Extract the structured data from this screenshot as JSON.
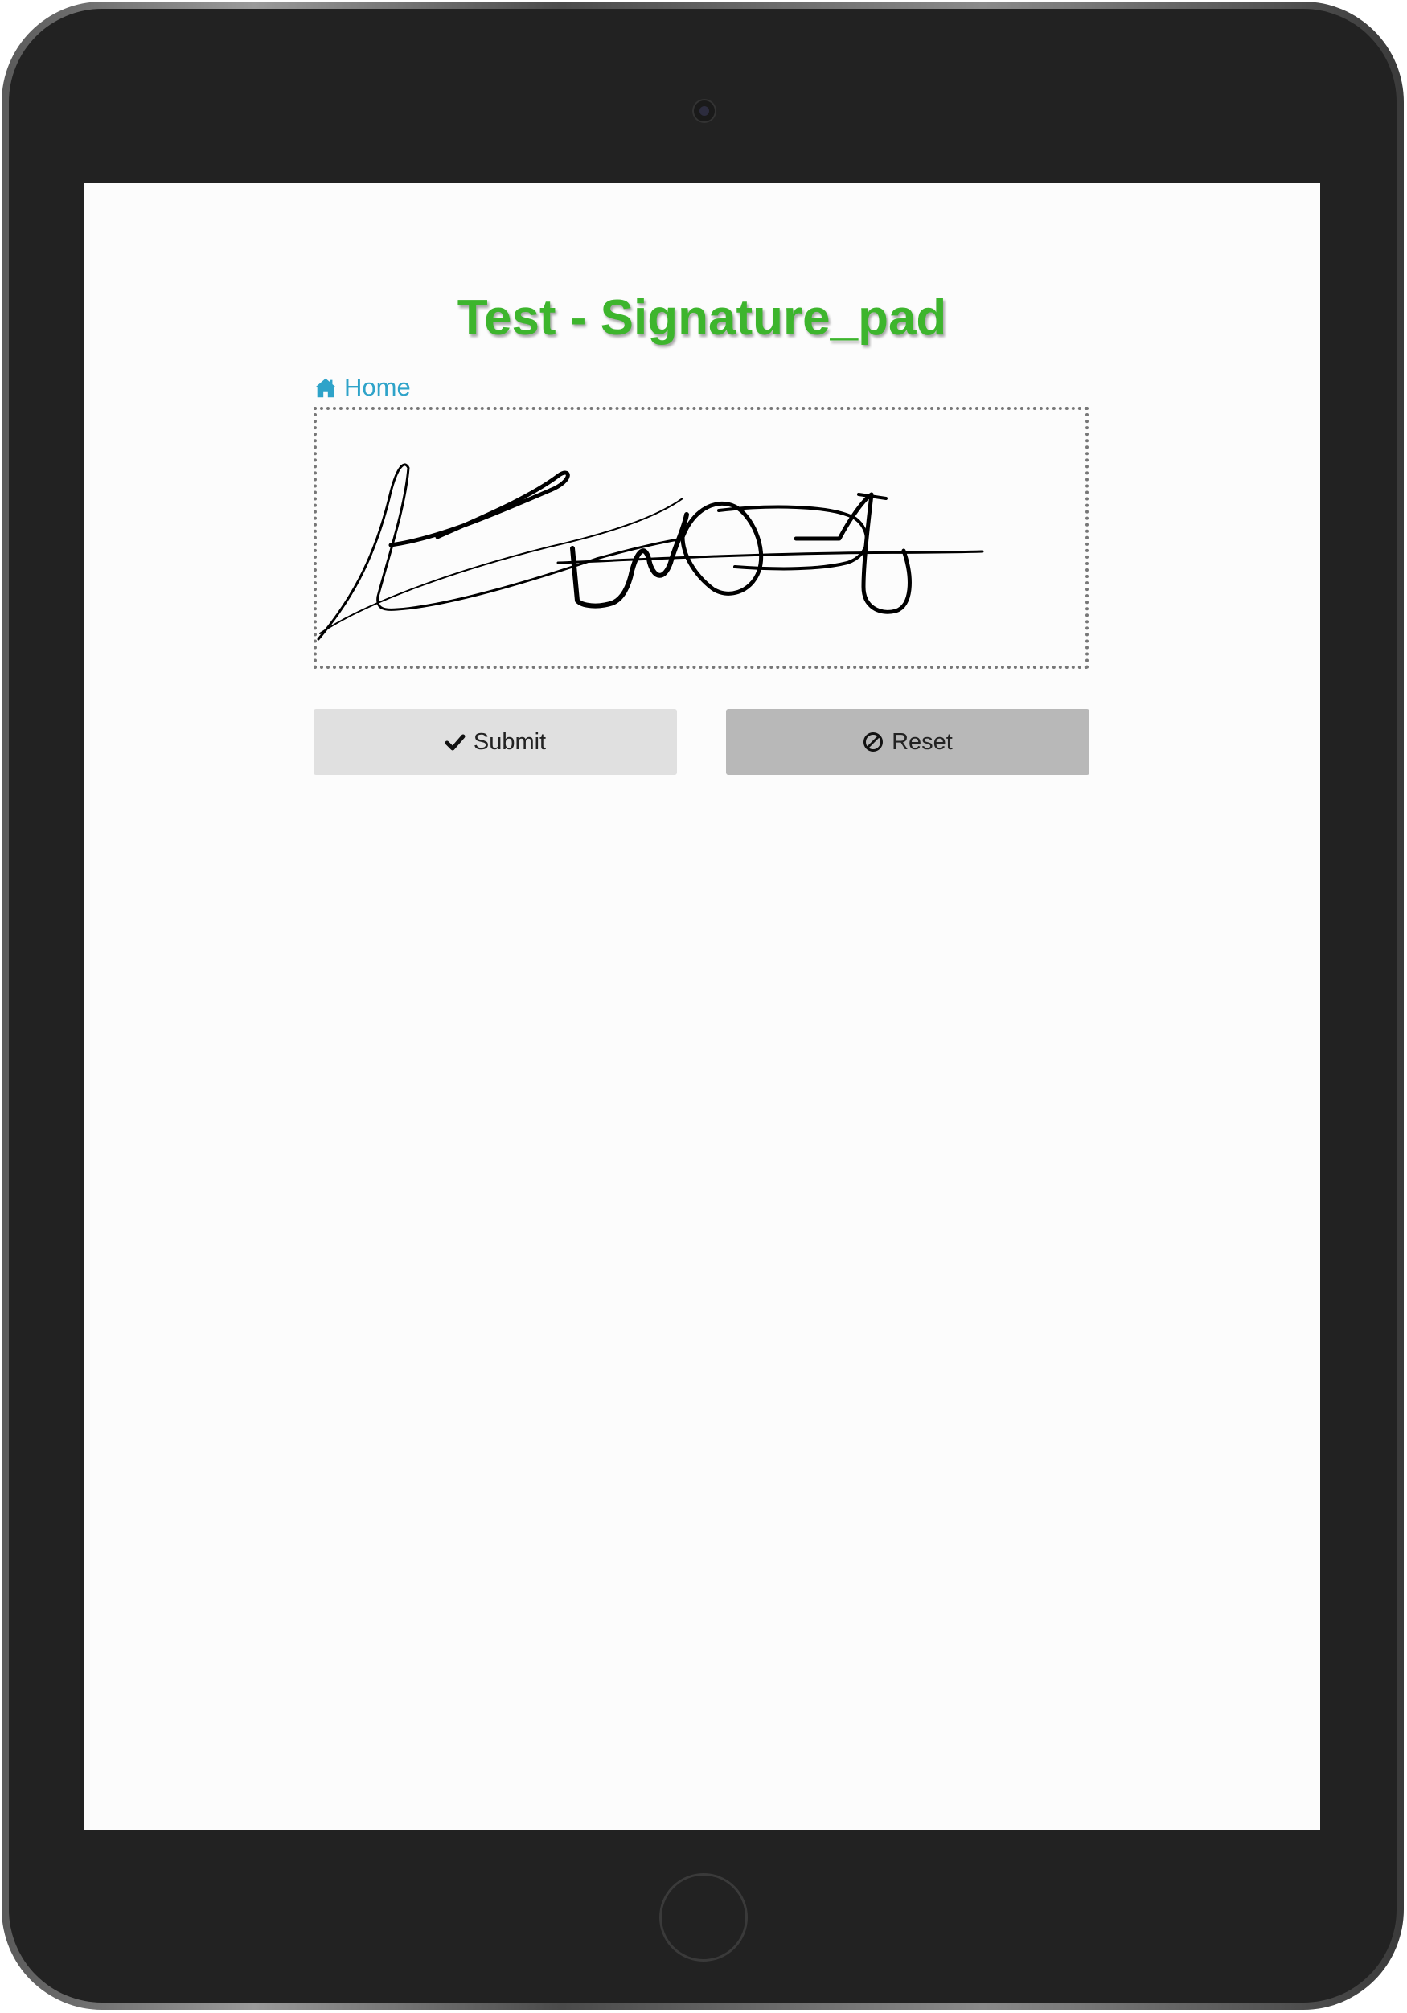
{
  "page": {
    "title": "Test - Signature_pad",
    "accent_color": "#3db52d",
    "link_color": "#2ea3c9"
  },
  "nav": {
    "home_label": "Home",
    "home_icon": "home-icon"
  },
  "signature_pad": {
    "has_signature": true
  },
  "buttons": {
    "submit_label": "Submit",
    "submit_icon": "check-icon",
    "reset_label": "Reset",
    "reset_icon": "ban-icon"
  }
}
